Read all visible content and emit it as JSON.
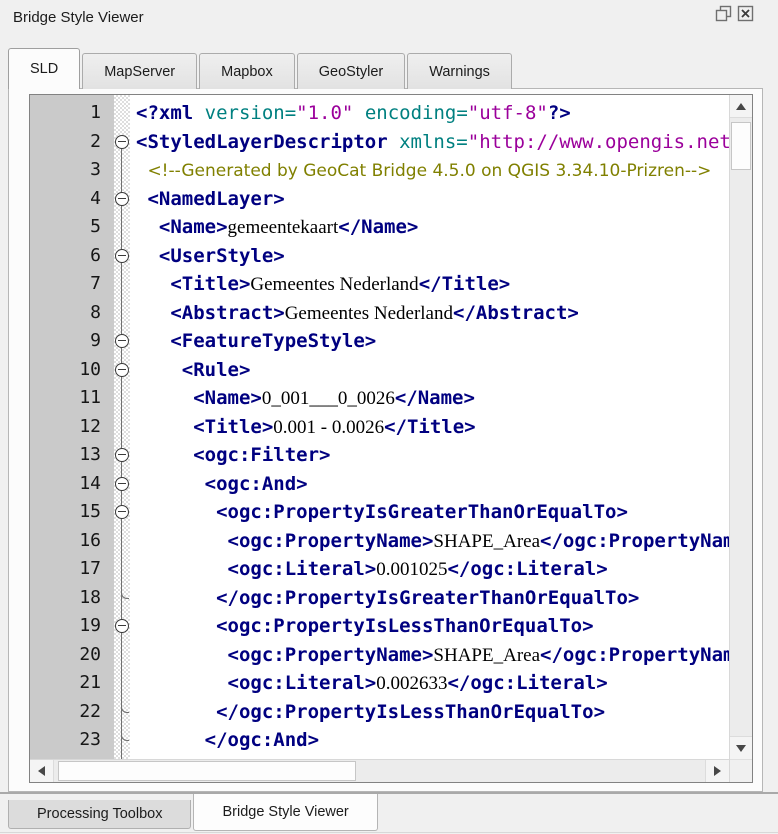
{
  "panel": {
    "title": "Bridge Style Viewer"
  },
  "titlebar": {
    "buttons": [
      {
        "icon": "float-icon"
      },
      {
        "icon": "close-icon"
      }
    ]
  },
  "top_tabs": [
    {
      "label": "SLD",
      "active": true
    },
    {
      "label": "MapServer",
      "active": false
    },
    {
      "label": "Mapbox",
      "active": false
    },
    {
      "label": "GeoStyler",
      "active": false
    },
    {
      "label": "Warnings",
      "active": false
    }
  ],
  "bottom_tabs": [
    {
      "label": "Processing Toolbox",
      "active": false
    },
    {
      "label": "Bridge Style Viewer",
      "active": true
    }
  ],
  "colors": {
    "tag": "#000080",
    "attribute": "#008080",
    "string": "#9b009b",
    "comment": "#808000",
    "text": "#000000",
    "gutter_bg": "#cacaca"
  },
  "editor": {
    "language": "xml",
    "lines": [
      {
        "n": 1,
        "indent": 0,
        "fold": "none",
        "tokens": [
          [
            "tag",
            "<?xml "
          ],
          [
            "attr",
            "version="
          ],
          [
            "str",
            "\"1.0\""
          ],
          [
            "sp",
            " "
          ],
          [
            "attr",
            "encoding="
          ],
          [
            "str",
            "\"utf-8\""
          ],
          [
            "tag",
            "?>"
          ]
        ]
      },
      {
        "n": 2,
        "indent": 0,
        "fold": "open",
        "tokens": [
          [
            "tag",
            "<StyledLayerDescriptor "
          ],
          [
            "attr",
            "xmlns="
          ],
          [
            "str",
            "\"http://www.opengis.net/sld\""
          ]
        ]
      },
      {
        "n": 3,
        "indent": 1,
        "fold": "line",
        "tokens": [
          [
            "com",
            "<!--Generated by GeoCat Bridge 4.5.0 on QGIS 3.34.10-Prizren-->"
          ]
        ]
      },
      {
        "n": 4,
        "indent": 1,
        "fold": "open",
        "tokens": [
          [
            "tag",
            "<NamedLayer>"
          ]
        ]
      },
      {
        "n": 5,
        "indent": 2,
        "fold": "line",
        "tokens": [
          [
            "tag",
            "<Name>"
          ],
          [
            "txt",
            "gemeentekaart"
          ],
          [
            "tag",
            "</Name>"
          ]
        ]
      },
      {
        "n": 6,
        "indent": 2,
        "fold": "open",
        "tokens": [
          [
            "tag",
            "<UserStyle>"
          ]
        ]
      },
      {
        "n": 7,
        "indent": 3,
        "fold": "line",
        "tokens": [
          [
            "tag",
            "<Title>"
          ],
          [
            "txt",
            "Gemeentes Nederland"
          ],
          [
            "tag",
            "</Title>"
          ]
        ]
      },
      {
        "n": 8,
        "indent": 3,
        "fold": "line",
        "tokens": [
          [
            "tag",
            "<Abstract>"
          ],
          [
            "txt",
            "Gemeentes Nederland"
          ],
          [
            "tag",
            "</Abstract>"
          ]
        ]
      },
      {
        "n": 9,
        "indent": 3,
        "fold": "open",
        "tokens": [
          [
            "tag",
            "<FeatureTypeStyle>"
          ]
        ]
      },
      {
        "n": 10,
        "indent": 4,
        "fold": "open",
        "tokens": [
          [
            "tag",
            "<Rule>"
          ]
        ]
      },
      {
        "n": 11,
        "indent": 5,
        "fold": "line",
        "tokens": [
          [
            "tag",
            "<Name>"
          ],
          [
            "txt",
            "0_001___0_0026"
          ],
          [
            "tag",
            "</Name>"
          ]
        ]
      },
      {
        "n": 12,
        "indent": 5,
        "fold": "line",
        "tokens": [
          [
            "tag",
            "<Title>"
          ],
          [
            "txt",
            "0.001 - 0.0026"
          ],
          [
            "tag",
            "</Title>"
          ]
        ]
      },
      {
        "n": 13,
        "indent": 5,
        "fold": "open",
        "tokens": [
          [
            "tag",
            "<ogc:Filter>"
          ]
        ]
      },
      {
        "n": 14,
        "indent": 6,
        "fold": "open",
        "tokens": [
          [
            "tag",
            "<ogc:And>"
          ]
        ]
      },
      {
        "n": 15,
        "indent": 7,
        "fold": "open",
        "tokens": [
          [
            "tag",
            "<ogc:PropertyIsGreaterThanOrEqualTo>"
          ]
        ]
      },
      {
        "n": 16,
        "indent": 8,
        "fold": "line",
        "tokens": [
          [
            "tag",
            "<ogc:PropertyName>"
          ],
          [
            "txt",
            "SHAPE_Area"
          ],
          [
            "tag",
            "</ogc:PropertyName>"
          ]
        ]
      },
      {
        "n": 17,
        "indent": 8,
        "fold": "line",
        "tokens": [
          [
            "tag",
            "<ogc:Literal>"
          ],
          [
            "txt",
            "0.001025"
          ],
          [
            "tag",
            "</ogc:Literal>"
          ]
        ]
      },
      {
        "n": 18,
        "indent": 7,
        "fold": "end",
        "tokens": [
          [
            "tag",
            "</ogc:PropertyIsGreaterThanOrEqualTo>"
          ]
        ]
      },
      {
        "n": 19,
        "indent": 7,
        "fold": "open",
        "tokens": [
          [
            "tag",
            "<ogc:PropertyIsLessThanOrEqualTo>"
          ]
        ]
      },
      {
        "n": 20,
        "indent": 8,
        "fold": "line",
        "tokens": [
          [
            "tag",
            "<ogc:PropertyName>"
          ],
          [
            "txt",
            "SHAPE_Area"
          ],
          [
            "tag",
            "</ogc:PropertyName>"
          ]
        ]
      },
      {
        "n": 21,
        "indent": 8,
        "fold": "line",
        "tokens": [
          [
            "tag",
            "<ogc:Literal>"
          ],
          [
            "txt",
            "0.002633"
          ],
          [
            "tag",
            "</ogc:Literal>"
          ]
        ]
      },
      {
        "n": 22,
        "indent": 7,
        "fold": "end",
        "tokens": [
          [
            "tag",
            "</ogc:PropertyIsLessThanOrEqualTo>"
          ]
        ]
      },
      {
        "n": 23,
        "indent": 6,
        "fold": "end",
        "tokens": [
          [
            "tag",
            "</ogc:And>"
          ]
        ]
      }
    ]
  }
}
